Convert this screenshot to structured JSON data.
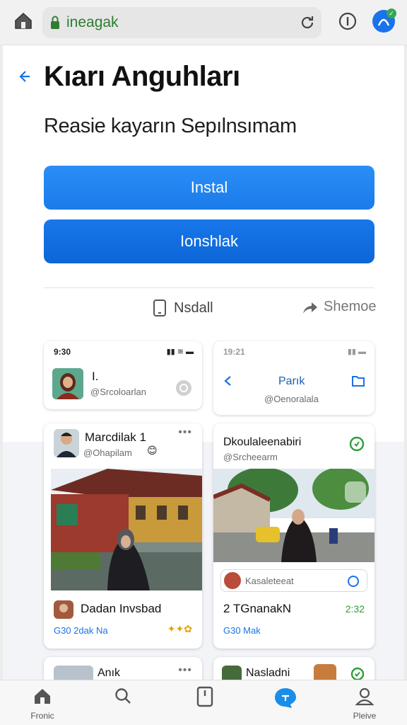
{
  "browser": {
    "url": "ineagak"
  },
  "page": {
    "title": "Kıarı Anguhları",
    "subtitle": "Reasie kayarın Sepılnsımam",
    "primary_button": "Instal",
    "secondary_button": "Ionshlak",
    "action_install": "Nsdall",
    "action_share": "Shemoe"
  },
  "screens": {
    "left": {
      "status_time": "9:30",
      "profile": {
        "name": "I.",
        "handle": "@Srcoloarlan"
      },
      "post": {
        "name": "Marcdilak 1",
        "handle": "@Ohapilam",
        "footer_name": "Dadan Invsbad",
        "footer_meta": "G30 2dak Na"
      },
      "next": {
        "name": "Anık"
      }
    },
    "right": {
      "status_time": "19:21",
      "header_title": "Parık",
      "header_handle": "@Oenoralala",
      "post": {
        "name": "Dkoulaleenabiri",
        "handle": "@Srcheearm",
        "comment_handle": "Kasaleteeat",
        "footer_name": "2 TGnanakN",
        "footer_meta": "G30 Mak",
        "footer_stat": "2:32"
      },
      "next": {
        "name": "Nasladni"
      }
    }
  },
  "nav": {
    "home": "Fronic",
    "profile": "Pleive"
  },
  "colors": {
    "primary": "#1a7bea",
    "accent_green": "#2e9d3a"
  }
}
